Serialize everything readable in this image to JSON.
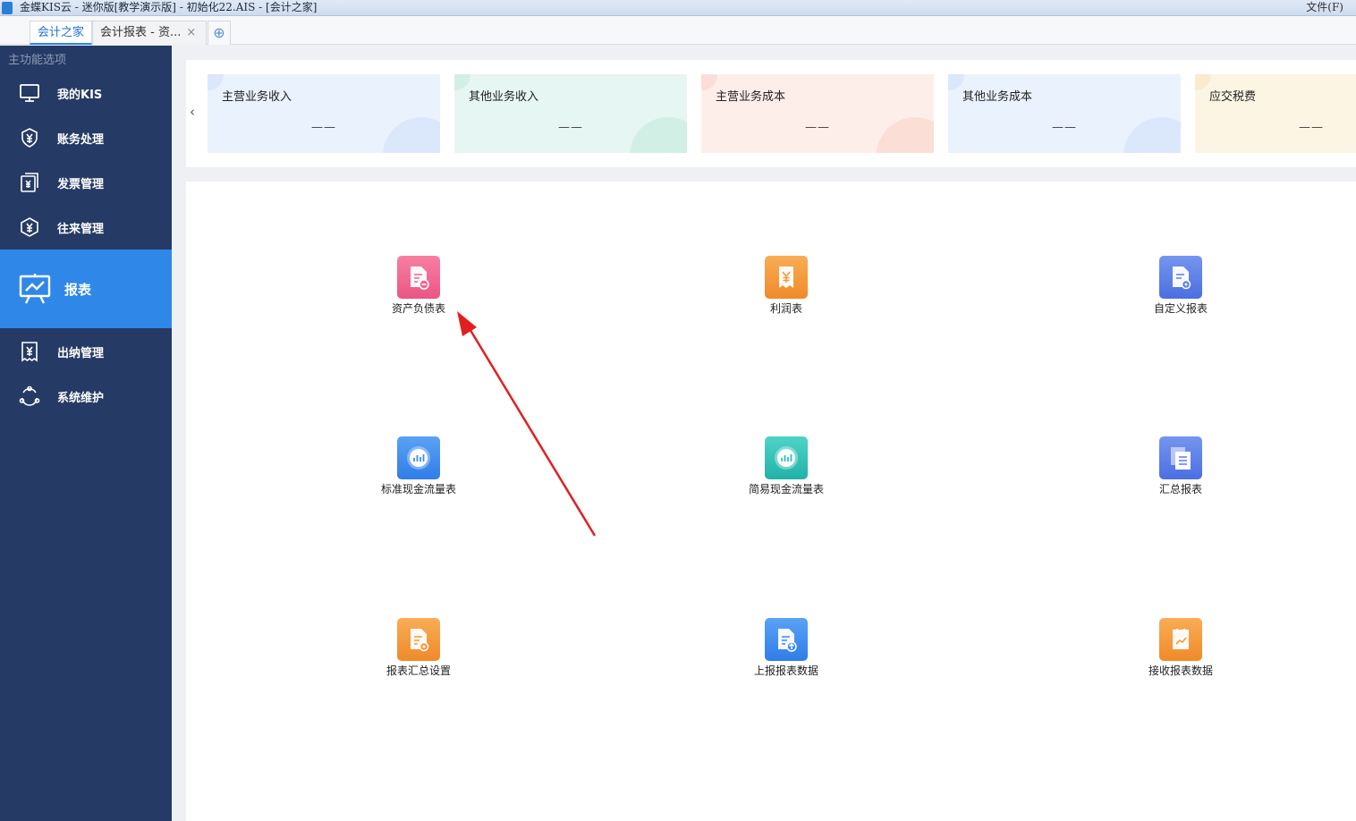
{
  "titlebar": {
    "title": "金蝶KIS云 - 迷你版[教学演示版] - 初始化22.AIS - [会计之家]",
    "file_menu": "文件(F)"
  },
  "tabs": [
    {
      "label": "会计之家",
      "active": true
    },
    {
      "label": "会计报表 - 资..."
    }
  ],
  "tab_add_icon": "plus-icon",
  "sidebar": {
    "title": "主功能选项",
    "items": [
      {
        "label": "我的KIS",
        "icon": "monitor-icon"
      },
      {
        "label": "账务处理",
        "icon": "yuan-shield-icon"
      },
      {
        "label": "发票管理",
        "icon": "invoice-icon"
      },
      {
        "label": "往来管理",
        "icon": "exchange-icon"
      },
      {
        "label": "报表",
        "icon": "chart-board-icon",
        "active": true
      },
      {
        "label": "出纳管理",
        "icon": "cashier-icon"
      },
      {
        "label": "系统维护",
        "icon": "maintenance-icon"
      }
    ]
  },
  "summary": {
    "prev_icon": "chevron-left-icon",
    "cards": [
      {
        "label": "主营业务收入",
        "value": "——",
        "bg": "#eaf2fd",
        "deco": "#dbe8fb"
      },
      {
        "label": "其他业务收入",
        "value": "——",
        "bg": "#e6f6f2",
        "deco": "#d2efe5"
      },
      {
        "label": "主营业务成本",
        "value": "——",
        "bg": "#fdeeea",
        "deco": "#fbded6"
      },
      {
        "label": "其他业务成本",
        "value": "——",
        "bg": "#eaf2fd",
        "deco": "#dbe8fb"
      },
      {
        "label": "应交税费",
        "value": "——",
        "bg": "#fdf5e4",
        "deco": "#fbebcd"
      }
    ]
  },
  "functions": [
    {
      "label": "资产负债表",
      "icon": "balance-sheet-icon",
      "color": "#f0648e"
    },
    {
      "label": "利润表",
      "icon": "profit-statement-icon",
      "color": "#f39a3a"
    },
    {
      "label": "自定义报表",
      "icon": "custom-report-icon",
      "color": "#5b7fe8"
    },
    {
      "label": "标准现金流量表",
      "icon": "cash-flow-icon",
      "color": "#3d8cf0"
    },
    {
      "label": "简易现金流量表",
      "icon": "simple-cash-flow-icon",
      "color": "#2ec1b6"
    },
    {
      "label": "汇总报表",
      "icon": "summary-report-icon",
      "color": "#5b7fe8"
    },
    {
      "label": "报表汇总设置",
      "icon": "report-settings-icon",
      "color": "#f39a3a"
    },
    {
      "label": "上报报表数据",
      "icon": "upload-report-icon",
      "color": "#3d8cf0"
    },
    {
      "label": "接收报表数据",
      "icon": "receive-report-icon",
      "color": "#f39a3a"
    }
  ],
  "annotation": {
    "arrow_color": "#e02020"
  }
}
